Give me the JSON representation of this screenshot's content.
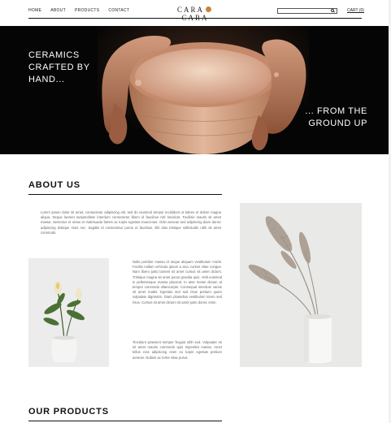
{
  "nav": {
    "items": [
      "HOME",
      "ABOUT",
      "PRODUCTS",
      "CONTACT"
    ]
  },
  "brand": {
    "left": "CARA",
    "right": "CARA",
    "accent": "#c8843e"
  },
  "search": {
    "placeholder": "",
    "icon": "search-icon"
  },
  "cart": {
    "label": "CART (0)"
  },
  "hero": {
    "tagline_left": "CERAMICS CRAFTED BY HAND...",
    "tagline_right": "... FROM THE GROUND UP"
  },
  "about": {
    "title": "ABOUT US",
    "paragraph_1": "Lorem ipsum dolor sit amet, consectetur adipiscing elit, sed do eiusmod tempor incididunt ut labore et dolore magna aliqua. Neque laoreet suspendisse interdum consectetur libero id faucibus nisl tincidunt. Facilisis mauris sit amet massa. Senectus et netus et malesuada fames ac turpis egestas maecenas. Odio aenean sed adipiscing diam donec adipiscing tristique risus nec. Sagittis id consectetur purus ut faucibus. Elit duis tristique sollicitudin nibh sit amet commodo.",
    "paragraph_2": "Nulla porttitor massa id neque aliquam vestibulum morbi. Facilisi nullam vehicula ipsum a arcu cursus vitae congue. Nam libero justo laoreet sit amet cursus sit amet dictum. Tristique magna sit amet purus gravida quis. Velit euismod in pellentesque massa placerat. In ante metus dictum at tempor commodo ullamcorper. Consequat interdum varius sit amet mattis. Egestas sed sed risus pretium quam vulputate dignissim. Diam phasellus vestibulum lorem sed risus. Cursus sit amet dictum sit amet justo donec enim.",
    "paragraph_3": "Tincidunt praesent semper feugiat nibh sed. Vulputate mi sit amet mauris commodo quis imperdiet massa. Amet tellus cras adipiscing enim eu turpis egestas pretium aenean. Nullam ac tortor vitae purus."
  },
  "products": {
    "title": "OUR PRODUCTS"
  },
  "colors": {
    "hero_bg": "#050505",
    "text": "#222222",
    "muted_text": "#666666"
  }
}
